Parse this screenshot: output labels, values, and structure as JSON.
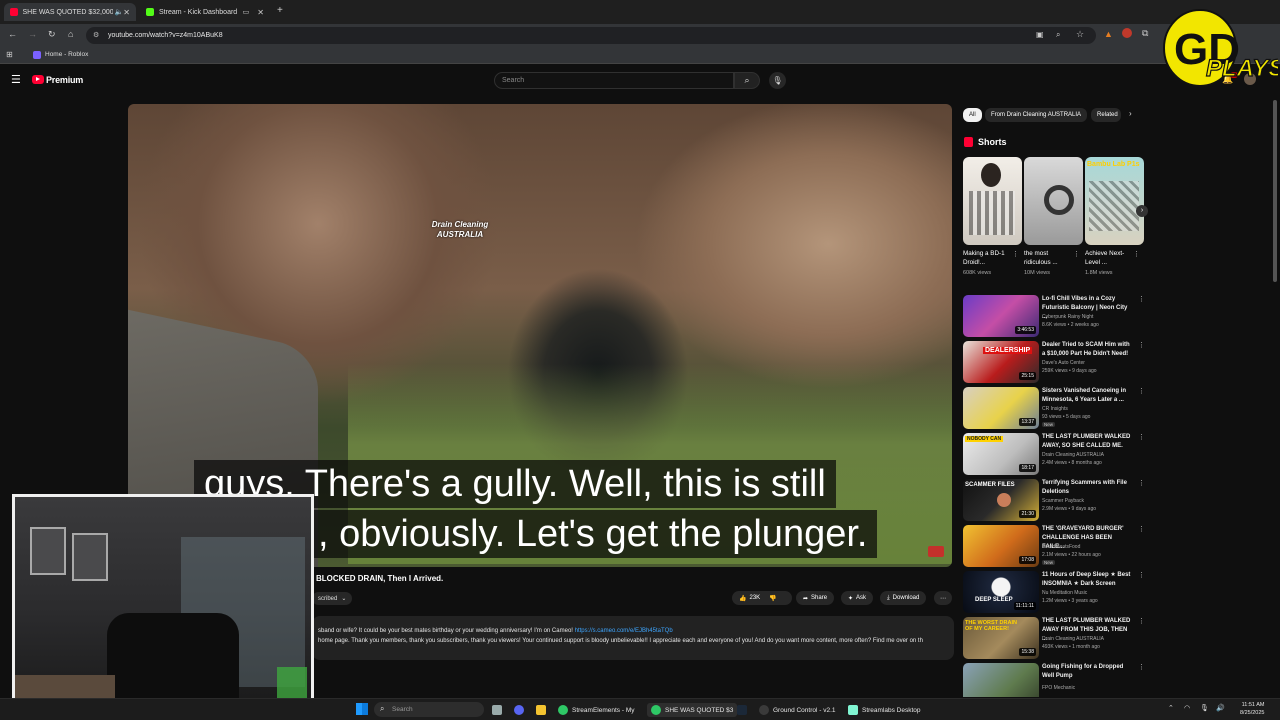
{
  "browser": {
    "tabs": [
      {
        "title": "SHE WAS QUOTED $32,000",
        "active": true,
        "favicon_color": "#ff0033"
      },
      {
        "title": "Stream - Kick Dashboard",
        "active": false,
        "favicon_color": "#53fc18"
      }
    ],
    "url": "youtube.com/watch?v=z4m10ABuK8",
    "bookmarks": [
      "Home - Roblox"
    ]
  },
  "youtube": {
    "brand": "Premium",
    "search_placeholder": "Search",
    "video": {
      "watermark_line1": "Drain Cleaning",
      "watermark_line2": "AUSTRALIA",
      "caption_line1": "guys. There's a gully. Well, this is still",
      "caption_line2": ", obviously. Let's get the plunger."
    },
    "title_visible": "BLOCKED DRAIN, Then I Arrived.",
    "subscribed_label": "scribed",
    "actions": {
      "likes": "23K",
      "share": "Share",
      "ask": "Ask",
      "download": "Download"
    },
    "description": {
      "line1_pre": "sband or wife? It could be your best mates birthday or your wedding anniversary! I'm on Cameo! ",
      "line1_link": "https://s.cameo.com/e/EJBh45taTQb",
      "line2": "home page. Thank you members, thank you subscribers, thank you viewers! Your continued support is bloody unbelievable!! I appreciate each and everyone of you! And do you want more content, more often? Find me over on th"
    },
    "chips": [
      "All",
      "From Drain Cleaning AUSTRALIA",
      "Related"
    ],
    "shorts_heading": "Shorts",
    "shorts": [
      {
        "title": "Making a BD-1 Droid!...",
        "views": "608K views"
      },
      {
        "title": "the most ridiculous ...",
        "views": "10M views"
      },
      {
        "title": "Achieve Next-Level ...",
        "views": "1.8M views"
      }
    ],
    "recommended": [
      {
        "title": "Lo-fi Chill Vibes in a Cozy Futuristic Balcony | Neon City ...",
        "channel": "Cyberpunk Rainy Night",
        "meta": "8.6K views • 2 weeks ago",
        "duration": "3:46:53",
        "is_new": false
      },
      {
        "title": "Dealer Tried to SCAM Him with a $10,000 Part He Didn't Need!",
        "channel": "Dave's Auto Center",
        "meta": "259K views • 9 days ago",
        "duration": "25:15",
        "is_new": false
      },
      {
        "title": "Sisters Vanished Canoeing in Minnesota, 6 Years Later a ...",
        "channel": "CR Insights",
        "meta": "93 views • 5 days ago",
        "duration": "13:37",
        "is_new": true
      },
      {
        "title": "THE LAST PLUMBER WALKED AWAY, SO SHE CALLED ME.",
        "channel": "Drain Cleaning AUSTRALIA",
        "meta": "2.4M views • 8 months ago",
        "duration": "18:17",
        "is_new": false
      },
      {
        "title": "Terrifying Scammers with File Deletions",
        "channel": "Scammer Payback",
        "meta": "2.9M views • 9 days ago",
        "duration": "21:30",
        "is_new": false
      },
      {
        "title": "THE 'GRAVEYARD BURGER' CHALLENGE HAS BEEN FAILE...",
        "channel": "BeardMeatsFood",
        "meta": "2.1M views • 22 hours ago",
        "duration": "17:08",
        "is_new": true
      },
      {
        "title": "11 Hours of Deep Sleep ★ Best INSOMNIA ★ Dark Screen",
        "channel": "Nu Meditation Music",
        "meta": "1.2M views • 3 years ago",
        "duration": "11:11:11",
        "is_new": false
      },
      {
        "title": "THE LAST PLUMBER WALKED AWAY FROM THIS JOB, THEN ...",
        "channel": "Drain Cleaning AUSTRALIA",
        "meta": "493K views • 1 month ago",
        "duration": "15:38",
        "is_new": false
      },
      {
        "title": "Going Fishing for a Dropped Well Pump",
        "channel": "FPO Mechanic",
        "meta": "",
        "duration": "",
        "is_new": false
      }
    ]
  },
  "taskbar": {
    "search_placeholder": "Search",
    "apps": [
      "StreamElements - My",
      "SHE WAS QUOTED $3",
      "Ground Control - v2.1",
      "Streamlabs Desktop"
    ],
    "time": "11:51 AM",
    "date": "8/25/2025"
  },
  "overlay_logo_text": "GD PLAYS",
  "colors": {
    "accent_red": "#ff0033",
    "link_blue": "#3ea6ff",
    "logo_yellow": "#f2e600"
  }
}
